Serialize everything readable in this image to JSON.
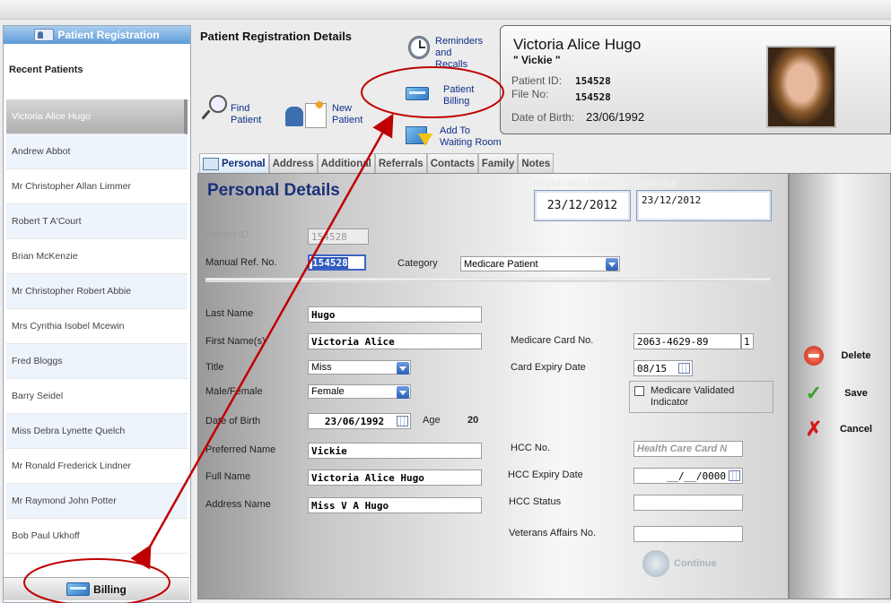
{
  "sidebar": {
    "header": "Patient Registration",
    "recent_title": "Recent Patients",
    "patients": [
      "Victoria Alice Hugo",
      "Andrew Abbot",
      "Mr Christopher Allan Limmer",
      "Robert T A'Court",
      "Brian McKenzie",
      "Mr Christopher Robert Abbie",
      "Mrs Cynthia Isobel Mcewin",
      "Fred Bloggs",
      "Barry Seidel",
      "Miss Debra Lynette Quelch",
      "Mr Ronald Frederick Lindner",
      "Mr Raymond John Potter",
      "Bob Paul Ukhoff"
    ],
    "billing_label": "Billing"
  },
  "toolbar": {
    "title": "Patient Registration Details",
    "reminders": [
      "Reminders",
      "and",
      "Recalls"
    ],
    "billing": [
      "Patient",
      "Billing"
    ],
    "find": [
      "Find",
      "Patient"
    ],
    "new": [
      "New",
      "Patient"
    ],
    "waiting": [
      "Add To",
      "Waiting Room"
    ]
  },
  "patient_card": {
    "name": "Victoria Alice Hugo",
    "nickname": "\" Vickie \"",
    "id_label": "Patient ID:",
    "id_value": "154528",
    "file_label": "File No:",
    "file_value": "154528",
    "dob_label": "Date of Birth:",
    "dob_value": "23/06/1992"
  },
  "tabs": [
    "Personal",
    "Address",
    "Additional",
    "Referrals",
    "Contacts",
    "Family",
    "Notes"
  ],
  "form": {
    "title": "Personal Details",
    "reg_date_label": "Registration Date",
    "reg_date": "23/12/2012",
    "last_visit_label": "Last Visit",
    "last_visit": "23/12/2012",
    "patient_id_label": "Patient ID",
    "patient_id": "154528",
    "manual_ref_label": "Manual Ref. No.",
    "manual_ref": "154528",
    "category_label": "Category",
    "category": "Medicare Patient",
    "last_name_label": "Last Name",
    "last_name": "Hugo",
    "first_name_label": "First Name(s)",
    "first_name": "Victoria Alice",
    "title_label": "Title",
    "title_value": "Miss",
    "sex_label": "Male/Female",
    "sex_value": "Female",
    "dob_label": "Date of Birth",
    "dob": "23/06/1992",
    "age_label": "Age",
    "age": "20",
    "preferred_label": "Preferred Name",
    "preferred": "Vickie",
    "full_label": "Full Name",
    "full": "Victoria Alice Hugo",
    "address_name_label": "Address Name",
    "address_name": "Miss V A Hugo",
    "medicare_label": "Medicare Card No.",
    "medicare": "2063-4629-89",
    "medicare_irn": "1",
    "card_expiry_label": "Card Expiry Date",
    "card_expiry": "08/15",
    "medicare_validated": [
      "Medicare Validated",
      "Indicator"
    ],
    "hcc_label": "HCC No.",
    "hcc_placeholder": "Health Care Card N",
    "hcc_expiry_label": "HCC Expiry Date",
    "hcc_expiry": "__/__/0000",
    "hcc_status_label": "HCC Status",
    "vet_label": "Veterans Affairs No.",
    "continue": "Continue"
  },
  "actions": {
    "delete": "Delete",
    "save": "Save",
    "cancel": "Cancel"
  },
  "colors": {
    "annotation": "#c00000",
    "title_blue": "#1a2f7a"
  }
}
